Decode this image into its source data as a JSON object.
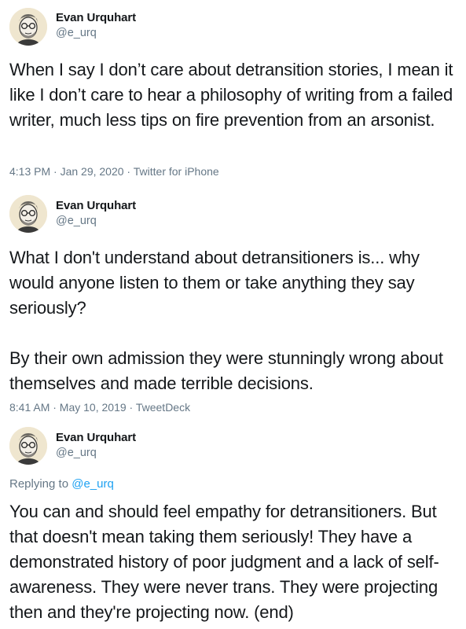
{
  "tweets": [
    {
      "author": "Evan Urquhart",
      "handle": "@e_urq",
      "replying_to": "",
      "text": "When I say I don’t care about detransition stories, I mean it like I don’t care to hear a philosophy of writing from a failed writer, much less tips on fire prevention from an arsonist.",
      "timestamp": "4:13 PM · Jan 29, 2020",
      "source": "Twitter for iPhone"
    },
    {
      "author": "Evan Urquhart",
      "handle": "@e_urq",
      "replying_to": "",
      "text": "What I don't understand about detransitioners is... why would anyone listen to them or take anything they say seriously?\n\nBy their own admission they were stunningly wrong about themselves and made terrible decisions.",
      "timestamp": "8:41 AM · May 10, 2019",
      "source": "TweetDeck"
    },
    {
      "author": "Evan Urquhart",
      "handle": "@e_urq",
      "replying_label": "Replying to",
      "replying_to": "@e_urq",
      "text": "You can and should feel empathy for detransitioners. But that doesn't mean taking them seriously! They have a demonstrated history of poor judgment and a lack of self-awareness. They were never trans. They were projecting then and they're projecting now. (end)",
      "timestamp": "",
      "source": ""
    }
  ],
  "meta_separator": " · ",
  "colors": {
    "text": "#14171a",
    "secondary": "#657786",
    "link": "#1da1f2"
  }
}
